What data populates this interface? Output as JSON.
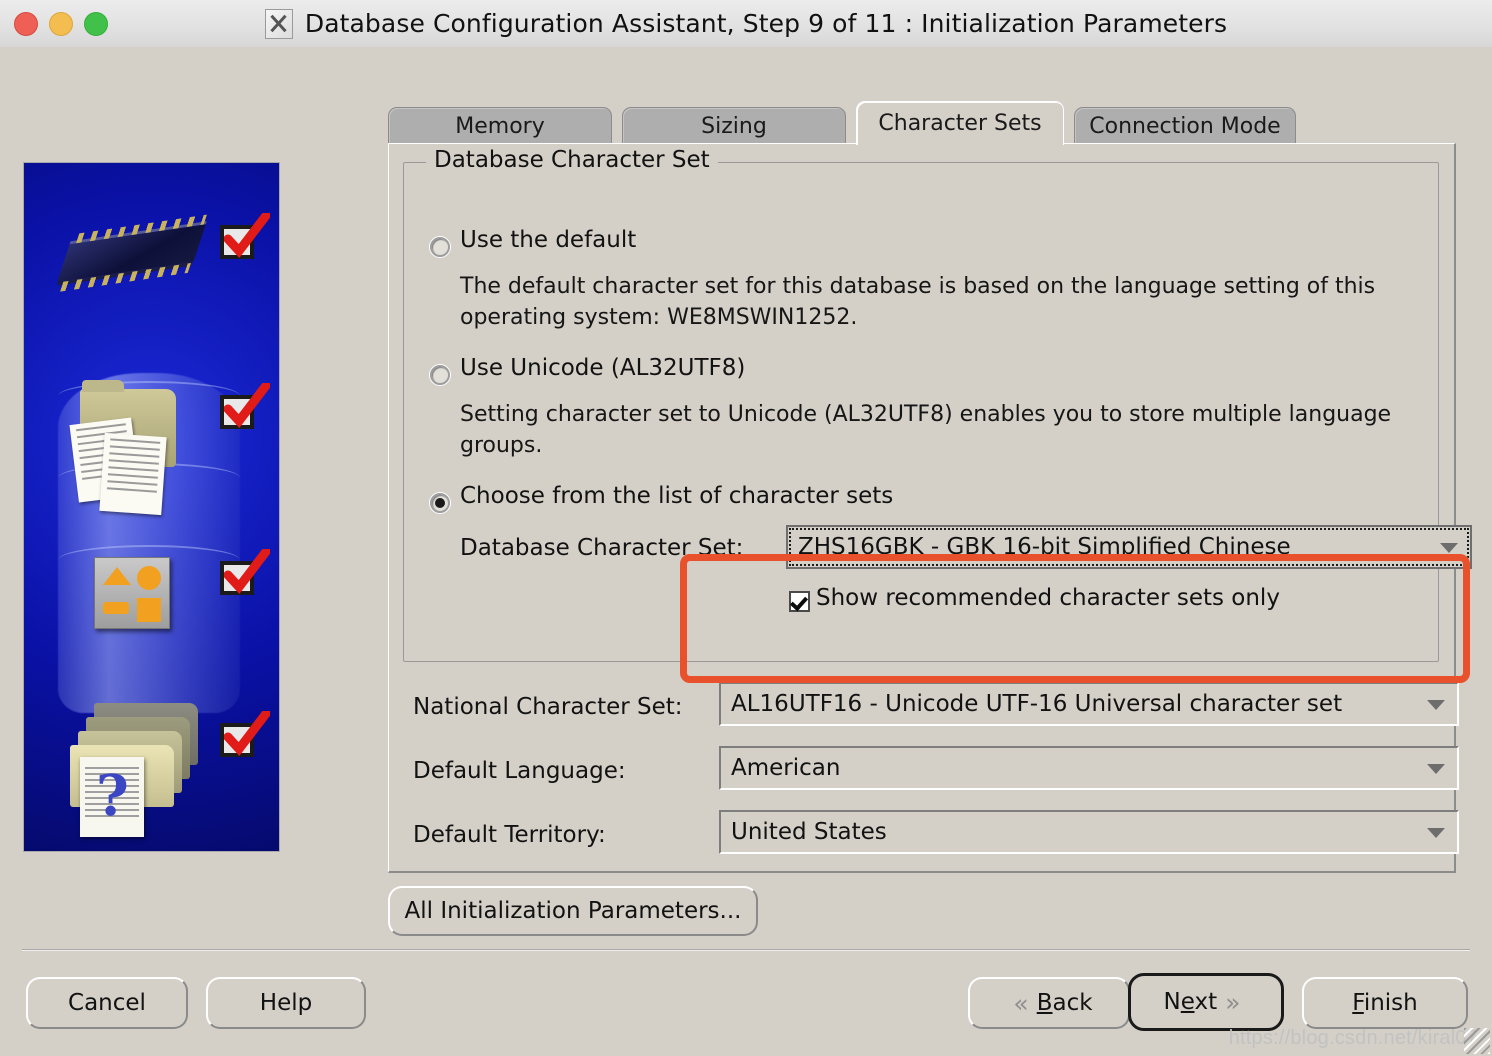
{
  "window": {
    "title": "Database Configuration Assistant, Step 9 of 11 : Initialization Parameters",
    "app_icon": "x11-icon",
    "traffic_lights": {
      "close": "close-button",
      "minimize": "minimize-button",
      "zoom": "zoom-button"
    }
  },
  "tabs": [
    {
      "label": "Memory",
      "selected": false
    },
    {
      "label": "Sizing",
      "selected": false
    },
    {
      "label": "Character Sets",
      "selected": true
    },
    {
      "label": "Connection Mode",
      "selected": false
    }
  ],
  "group": {
    "title": "Database Character Set",
    "options": [
      {
        "label": "Use the default",
        "selected": false,
        "description": "The default character set for this database is based on the language setting of this operating system: WE8MSWIN1252."
      },
      {
        "label": "Use Unicode (AL32UTF8)",
        "selected": false,
        "description": "Setting character set to Unicode (AL32UTF8) enables you to store multiple language groups."
      },
      {
        "label": "Choose from the list of character sets",
        "selected": true,
        "description": ""
      }
    ],
    "db_charset": {
      "label": "Database Character Set:",
      "value": "ZHS16GBK - GBK 16-bit Simplified Chinese"
    },
    "show_recommended": {
      "label": "Show recommended character sets only",
      "checked": true
    }
  },
  "fields": [
    {
      "label": "National Character Set:",
      "value": "AL16UTF16 - Unicode UTF-16 Universal character set"
    },
    {
      "label": "Default Language:",
      "value": "American"
    },
    {
      "label": "Default Territory:",
      "value": "United States"
    }
  ],
  "all_params_button": "All Initialization Parameters...",
  "footer": {
    "cancel": "Cancel",
    "help": "Help",
    "back": {
      "mnemonic": "B",
      "rest": "ack"
    },
    "next": {
      "pre": "N",
      "mnemonic": "e",
      "rest": "xt"
    },
    "finish": {
      "mnemonic": "F",
      "rest": "inish"
    },
    "back_chevron": "«",
    "next_chevron": "»"
  },
  "watermark": "https://blog.csdn.net/kiral07",
  "colors": {
    "window_bg": "#d4d0c8",
    "titlebar_bg": "#e4e4e4",
    "annotation_red": "#e8512b",
    "tab_inactive": "#aeaeae",
    "artwork_blue": "#0a11a6"
  },
  "annotation": {
    "name": "highlight-rectangle",
    "color": "#e8512b"
  }
}
